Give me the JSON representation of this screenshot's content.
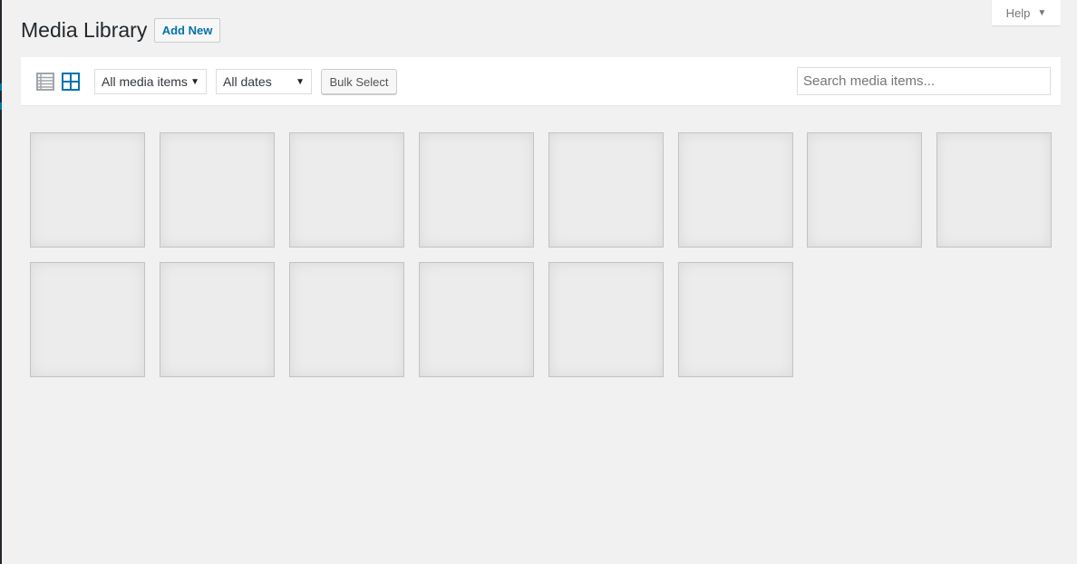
{
  "header": {
    "title": "Media Library",
    "add_new_label": "Add New",
    "help_label": "Help"
  },
  "toolbar": {
    "view_modes": [
      "list",
      "grid"
    ],
    "active_view": "grid",
    "type_filter": "All media items",
    "date_filter": "All dates",
    "bulk_select_label": "Bulk Select",
    "search_placeholder": "Search media items..."
  },
  "grid": {
    "tile_count": 14,
    "columns": 8
  },
  "colors": {
    "accent": "#0073aa",
    "background": "#f1f1f1"
  }
}
